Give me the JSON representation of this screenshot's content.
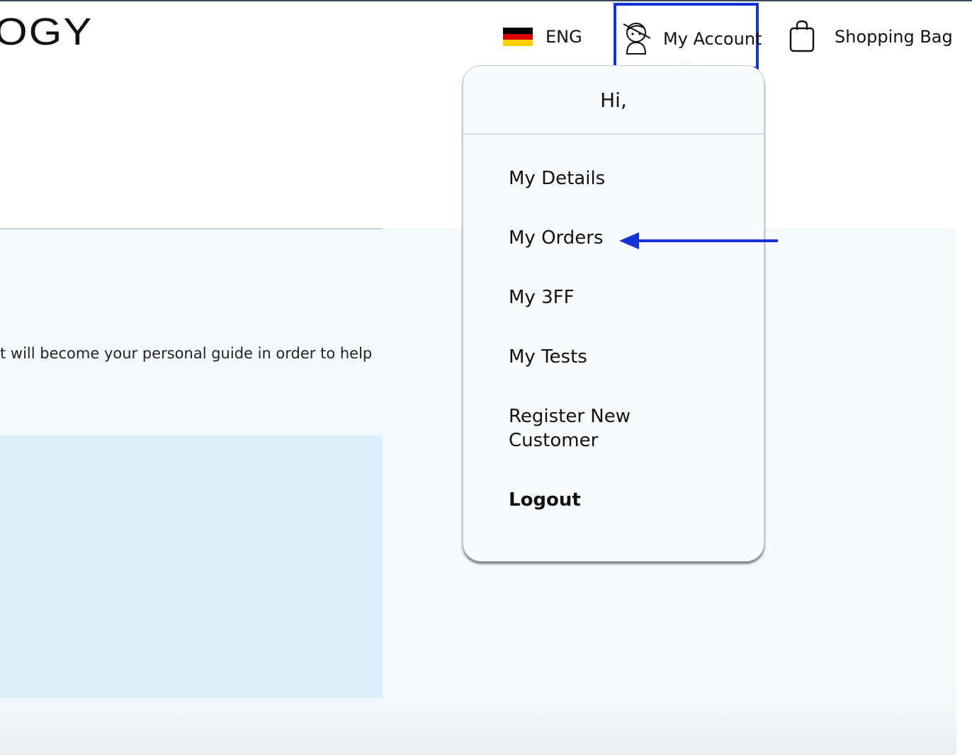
{
  "header": {
    "logo_text": "OGY",
    "language_label": "ENG",
    "account_label": "My Account",
    "bag_label": "Shopping Bag",
    "flag_colors": [
      "#000000",
      "#dd0000",
      "#ffce00"
    ]
  },
  "main": {
    "intro_text": "t will become your personal guide in order to help"
  },
  "account_menu": {
    "greeting": "Hi,",
    "items": [
      {
        "label": "My Details"
      },
      {
        "label": "My Orders"
      },
      {
        "label": "My 3FF"
      },
      {
        "label": "My Tests"
      },
      {
        "label": "Register New Customer"
      },
      {
        "label": "Logout"
      }
    ]
  },
  "colors": {
    "highlight": "#1432d6",
    "content_background": "#f4f9fd",
    "panel_blue": "#daeef9"
  },
  "icons": {
    "account": "user-avatar-icon",
    "bag": "shopping-bag-icon",
    "flag": "germany-flag-icon",
    "annotation": "left-arrow-icon"
  }
}
